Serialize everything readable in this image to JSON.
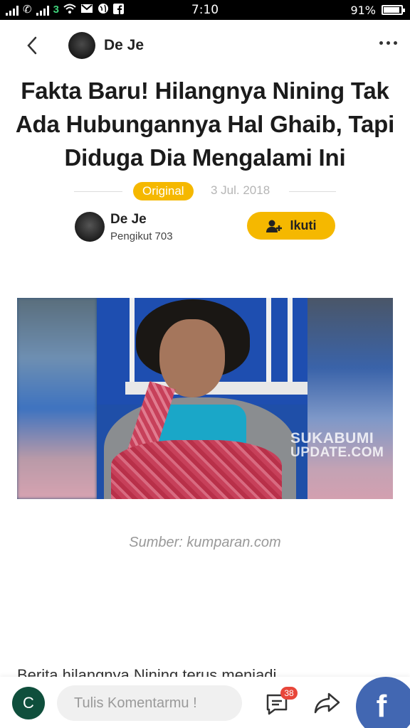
{
  "status_bar": {
    "time": "7:10",
    "battery": "91%",
    "battery_level": 0.91,
    "network_label": "3",
    "icons": [
      "signal-icon",
      "call-icon",
      "signal-icon",
      "network-3-icon",
      "wifi-icon",
      "mail-icon",
      "globe-icon",
      "facebook-icon",
      "battery-icon"
    ]
  },
  "header": {
    "author_name": "De Je"
  },
  "article": {
    "title": "Fakta Baru! Hilangnya Nining Tak Ada Hubungannya Hal Ghaib, Tapi Diduga Dia Mengalami Ini",
    "badge": "Original",
    "date": "3 Jul. 2018",
    "author": {
      "name": "De Je",
      "followers": "Pengikut 703"
    },
    "follow_label": "Ikuti",
    "image_watermark_line1": "SUKABUMI",
    "image_watermark_line2": "UPDATE.COM",
    "image_caption": "Sumber: kumparan.com",
    "body_preview": "Berita hilangnya Nining terus menjadi"
  },
  "bottom_bar": {
    "user_initial": "C",
    "comment_placeholder": "Tulis Komentarmu !",
    "comment_count": "38"
  },
  "colors": {
    "accent": "#f5b800",
    "facebook": "#4267b2",
    "badge_red": "#e8463a",
    "user_avatar": "#0f4f3c"
  }
}
